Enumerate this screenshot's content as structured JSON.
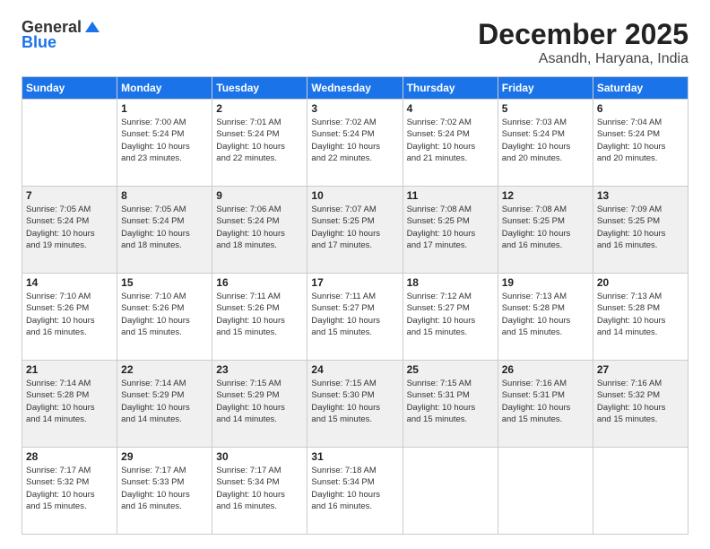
{
  "logo": {
    "text_general": "General",
    "text_blue": "Blue"
  },
  "header": {
    "month": "December 2025",
    "location": "Asandh, Haryana, India"
  },
  "weekdays": [
    "Sunday",
    "Monday",
    "Tuesday",
    "Wednesday",
    "Thursday",
    "Friday",
    "Saturday"
  ],
  "weeks": [
    [
      {
        "day": "",
        "info": ""
      },
      {
        "day": "1",
        "info": "Sunrise: 7:00 AM\nSunset: 5:24 PM\nDaylight: 10 hours\nand 23 minutes."
      },
      {
        "day": "2",
        "info": "Sunrise: 7:01 AM\nSunset: 5:24 PM\nDaylight: 10 hours\nand 22 minutes."
      },
      {
        "day": "3",
        "info": "Sunrise: 7:02 AM\nSunset: 5:24 PM\nDaylight: 10 hours\nand 22 minutes."
      },
      {
        "day": "4",
        "info": "Sunrise: 7:02 AM\nSunset: 5:24 PM\nDaylight: 10 hours\nand 21 minutes."
      },
      {
        "day": "5",
        "info": "Sunrise: 7:03 AM\nSunset: 5:24 PM\nDaylight: 10 hours\nand 20 minutes."
      },
      {
        "day": "6",
        "info": "Sunrise: 7:04 AM\nSunset: 5:24 PM\nDaylight: 10 hours\nand 20 minutes."
      }
    ],
    [
      {
        "day": "7",
        "info": "Sunrise: 7:05 AM\nSunset: 5:24 PM\nDaylight: 10 hours\nand 19 minutes."
      },
      {
        "day": "8",
        "info": "Sunrise: 7:05 AM\nSunset: 5:24 PM\nDaylight: 10 hours\nand 18 minutes."
      },
      {
        "day": "9",
        "info": "Sunrise: 7:06 AM\nSunset: 5:24 PM\nDaylight: 10 hours\nand 18 minutes."
      },
      {
        "day": "10",
        "info": "Sunrise: 7:07 AM\nSunset: 5:25 PM\nDaylight: 10 hours\nand 17 minutes."
      },
      {
        "day": "11",
        "info": "Sunrise: 7:08 AM\nSunset: 5:25 PM\nDaylight: 10 hours\nand 17 minutes."
      },
      {
        "day": "12",
        "info": "Sunrise: 7:08 AM\nSunset: 5:25 PM\nDaylight: 10 hours\nand 16 minutes."
      },
      {
        "day": "13",
        "info": "Sunrise: 7:09 AM\nSunset: 5:25 PM\nDaylight: 10 hours\nand 16 minutes."
      }
    ],
    [
      {
        "day": "14",
        "info": "Sunrise: 7:10 AM\nSunset: 5:26 PM\nDaylight: 10 hours\nand 16 minutes."
      },
      {
        "day": "15",
        "info": "Sunrise: 7:10 AM\nSunset: 5:26 PM\nDaylight: 10 hours\nand 15 minutes."
      },
      {
        "day": "16",
        "info": "Sunrise: 7:11 AM\nSunset: 5:26 PM\nDaylight: 10 hours\nand 15 minutes."
      },
      {
        "day": "17",
        "info": "Sunrise: 7:11 AM\nSunset: 5:27 PM\nDaylight: 10 hours\nand 15 minutes."
      },
      {
        "day": "18",
        "info": "Sunrise: 7:12 AM\nSunset: 5:27 PM\nDaylight: 10 hours\nand 15 minutes."
      },
      {
        "day": "19",
        "info": "Sunrise: 7:13 AM\nSunset: 5:28 PM\nDaylight: 10 hours\nand 15 minutes."
      },
      {
        "day": "20",
        "info": "Sunrise: 7:13 AM\nSunset: 5:28 PM\nDaylight: 10 hours\nand 14 minutes."
      }
    ],
    [
      {
        "day": "21",
        "info": "Sunrise: 7:14 AM\nSunset: 5:28 PM\nDaylight: 10 hours\nand 14 minutes."
      },
      {
        "day": "22",
        "info": "Sunrise: 7:14 AM\nSunset: 5:29 PM\nDaylight: 10 hours\nand 14 minutes."
      },
      {
        "day": "23",
        "info": "Sunrise: 7:15 AM\nSunset: 5:29 PM\nDaylight: 10 hours\nand 14 minutes."
      },
      {
        "day": "24",
        "info": "Sunrise: 7:15 AM\nSunset: 5:30 PM\nDaylight: 10 hours\nand 15 minutes."
      },
      {
        "day": "25",
        "info": "Sunrise: 7:15 AM\nSunset: 5:31 PM\nDaylight: 10 hours\nand 15 minutes."
      },
      {
        "day": "26",
        "info": "Sunrise: 7:16 AM\nSunset: 5:31 PM\nDaylight: 10 hours\nand 15 minutes."
      },
      {
        "day": "27",
        "info": "Sunrise: 7:16 AM\nSunset: 5:32 PM\nDaylight: 10 hours\nand 15 minutes."
      }
    ],
    [
      {
        "day": "28",
        "info": "Sunrise: 7:17 AM\nSunset: 5:32 PM\nDaylight: 10 hours\nand 15 minutes."
      },
      {
        "day": "29",
        "info": "Sunrise: 7:17 AM\nSunset: 5:33 PM\nDaylight: 10 hours\nand 16 minutes."
      },
      {
        "day": "30",
        "info": "Sunrise: 7:17 AM\nSunset: 5:34 PM\nDaylight: 10 hours\nand 16 minutes."
      },
      {
        "day": "31",
        "info": "Sunrise: 7:18 AM\nSunset: 5:34 PM\nDaylight: 10 hours\nand 16 minutes."
      },
      {
        "day": "",
        "info": ""
      },
      {
        "day": "",
        "info": ""
      },
      {
        "day": "",
        "info": ""
      }
    ]
  ]
}
